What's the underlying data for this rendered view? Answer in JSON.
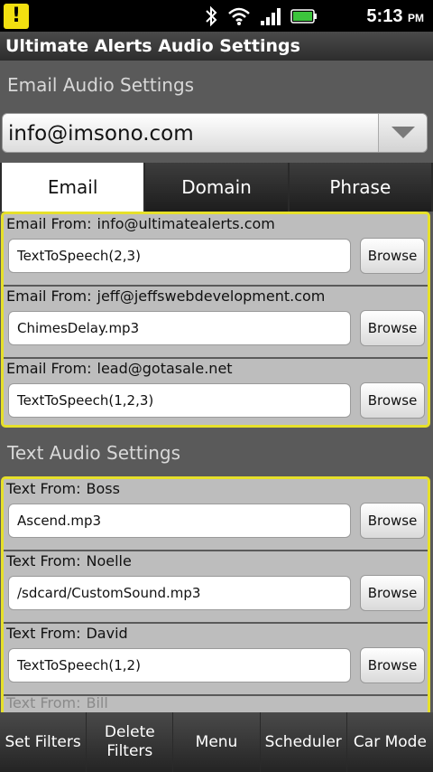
{
  "status_bar": {
    "notification_icon": "!",
    "time": "5:13",
    "ampm": "PM"
  },
  "app": {
    "title": "Ultimate Alerts Audio Settings"
  },
  "email_section": {
    "title": "Email Audio Settings",
    "account": "info@imsono.com",
    "tabs": [
      {
        "label": "Email",
        "active": true
      },
      {
        "label": "Domain",
        "active": false
      },
      {
        "label": "Phrase",
        "active": false
      }
    ],
    "rows": [
      {
        "prefix": "Email From:",
        "sender": "info@ultimatealerts.com",
        "sound": "TextToSpeech(2,3)",
        "browse": "Browse"
      },
      {
        "prefix": "Email From:",
        "sender": "jeff@jeffswebdevelopment.com",
        "sound": "ChimesDelay.mp3",
        "browse": "Browse"
      },
      {
        "prefix": "Email From:",
        "sender": "lead@gotasale.net",
        "sound": "TextToSpeech(1,2,3)",
        "browse": "Browse"
      }
    ]
  },
  "text_section": {
    "title": "Text Audio Settings",
    "rows": [
      {
        "prefix": "Text From:",
        "sender": "Boss",
        "sound": "Ascend.mp3",
        "browse": "Browse"
      },
      {
        "prefix": "Text From:",
        "sender": "Noelle",
        "sound": "/sdcard/CustomSound.mp3",
        "browse": "Browse"
      },
      {
        "prefix": "Text From:",
        "sender": "David",
        "sound": "TextToSpeech(1,2)",
        "browse": "Browse"
      }
    ],
    "clipped_row": {
      "prefix": "Text From:",
      "sender": "Bill"
    }
  },
  "bottom_menu": [
    "Set Filters",
    "Delete\nFilters",
    "Menu",
    "Scheduler",
    "Car Mode"
  ],
  "colors": {
    "highlight_border": "#e6e02a",
    "background": "#5a5a5a",
    "battery": "#3cc43c"
  }
}
